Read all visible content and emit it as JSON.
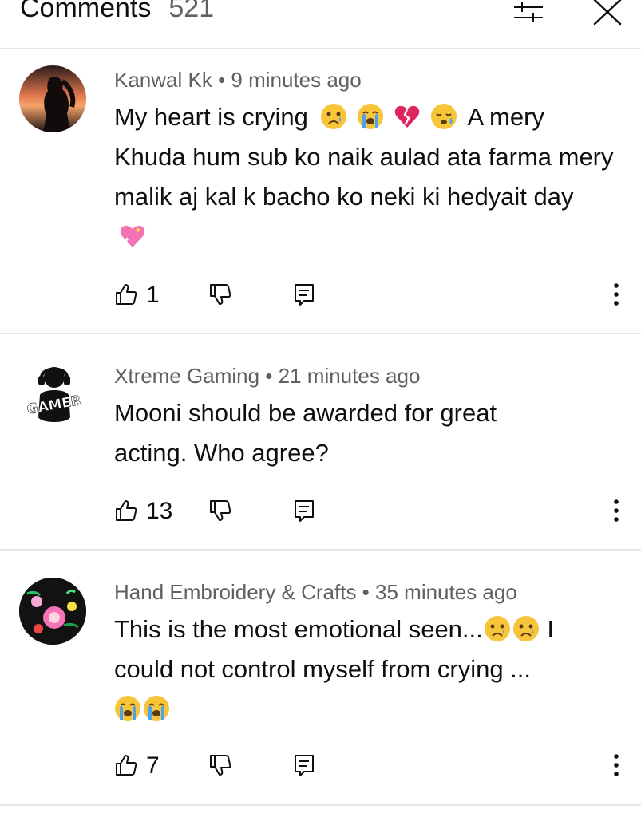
{
  "header": {
    "title": "Comments",
    "count": "521",
    "filter_icon": "sliders-icon",
    "close_icon": "close-icon"
  },
  "comments": [
    {
      "author": "Kanwal Kk",
      "time": "9 minutes ago",
      "text_parts": [
        "My heart  is crying",
        "A mery Khuda  hum sub ko naik aulad ata farma mery malik   aj kal k bacho ko neki ki hedyait day"
      ],
      "emojis": [
        "sad-face-emoji",
        "crying-face-emoji",
        "broken-heart-emoji",
        "sleepy-face-emoji",
        "sparkling-heart-emoji"
      ],
      "likes": "1"
    },
    {
      "author": "Xtreme Gaming",
      "time": "21 minutes ago",
      "text": "Mooni should be awarded for great acting. Who agree?",
      "avatar_text": "GAMER",
      "likes": "13"
    },
    {
      "author": "Hand Embroidery & Crafts",
      "time": "35 minutes ago",
      "text_parts": [
        "This is the most emotional seen...",
        "I could not control myself from crying ..."
      ],
      "emojis": [
        "sad-face-emoji",
        "sad-face-emoji",
        "crying-face-emoji",
        "crying-face-emoji"
      ],
      "likes": "7"
    }
  ],
  "separator": " • ",
  "colors": {
    "text": "#0f0f0f",
    "secondary": "#606060",
    "divider": "#e5e5e5",
    "emoji_yellow": "#f7c43a",
    "heart_red": "#e0245e",
    "sparkle_pink": "#f472b6"
  }
}
